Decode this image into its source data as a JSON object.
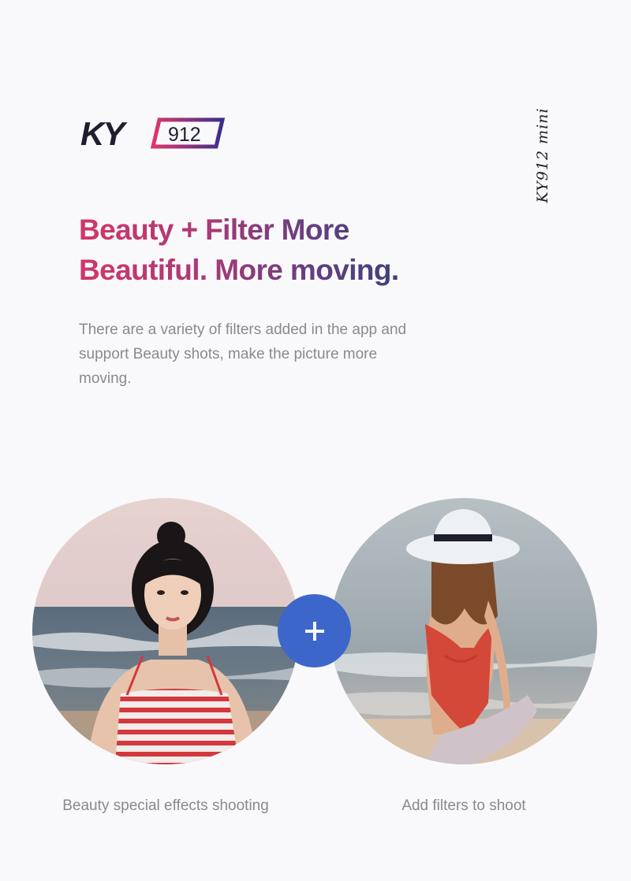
{
  "brand": {
    "logo_text": "KY",
    "logo_badge": "912",
    "side_label": "KY912 mini"
  },
  "headline": {
    "line1": "Beauty + Filter More",
    "line2": "Beautiful. More moving."
  },
  "description": "There are a variety of filters added in the app and support Beauty shots, make the picture more moving.",
  "features": [
    {
      "caption": "Beauty special effects shooting",
      "image": "woman-striped-top-beach-photo"
    },
    {
      "caption": "Add filters to shoot",
      "image": "woman-sun-hat-beach-photo"
    }
  ],
  "plus_icon": "plus-icon",
  "colors": {
    "accent_blue": "#3c66c9",
    "headline_start": "#d2366b",
    "headline_end": "#3b4079",
    "logo_dark": "#1e1e2e",
    "logo_badge_start": "#e0356b",
    "logo_badge_end": "#3b2e8a"
  }
}
